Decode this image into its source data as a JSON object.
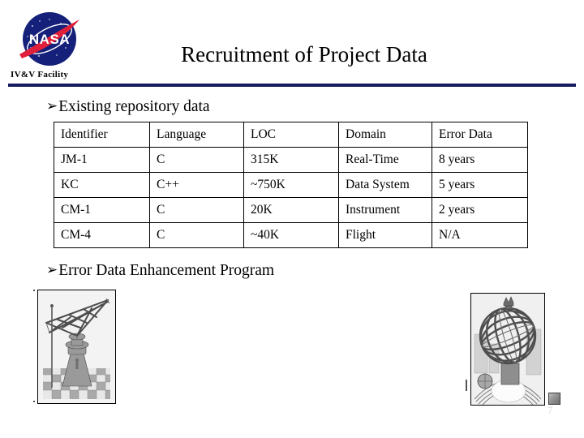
{
  "header": {
    "logo_icon": "nasa-meatball-logo",
    "org_label": "IV&V Facility",
    "title": "Recruitment of Project Data",
    "rule_color": "#161a5e"
  },
  "bullets": [
    {
      "marker": "➢",
      "text": "Existing repository data"
    },
    {
      "marker": "➢",
      "text": "Error Data Enhancement Program"
    }
  ],
  "table": {
    "headers": [
      "Identifier",
      "Language",
      "LOC",
      "Domain",
      "Error Data"
    ],
    "rows": [
      [
        "JM-1",
        "C",
        "315K",
        "Real-Time",
        "8 years"
      ],
      [
        "KC",
        "C++",
        "~750K",
        "Data System",
        "5 years"
      ],
      [
        "CM-1",
        "C",
        "20K",
        "Instrument",
        "2 years"
      ],
      [
        "CM-4",
        "C",
        "~40K",
        "Flight",
        "N/A"
      ]
    ]
  },
  "figures": [
    {
      "name": "crane-engraving",
      "caption": ""
    },
    {
      "name": "armillary-sphere-engraving",
      "caption": ""
    }
  ],
  "footer": {
    "page_number": "7"
  }
}
